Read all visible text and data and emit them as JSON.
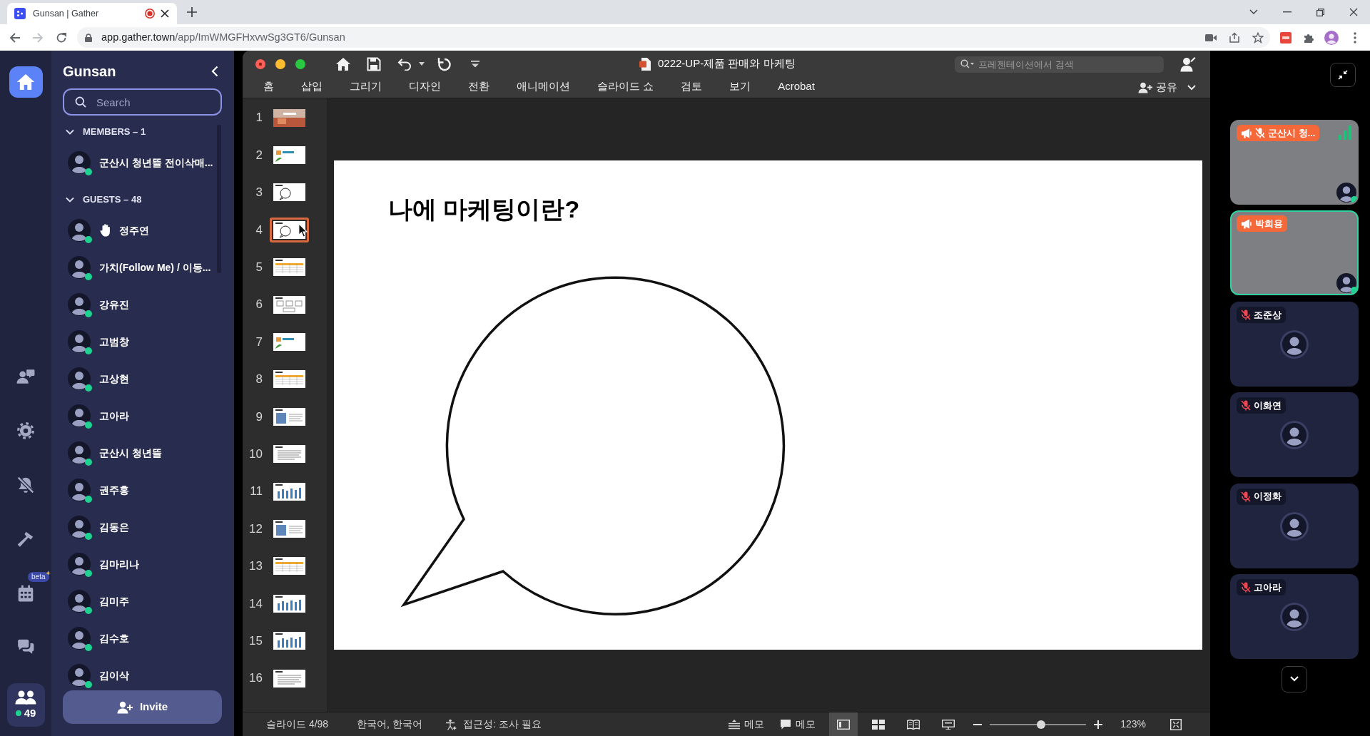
{
  "browser": {
    "tab_title": "Gunsan | Gather",
    "recording": true,
    "address": {
      "host": "app.gather.town",
      "path": "/app/ImWMGFHxvwSg3GT6/Gunsan"
    }
  },
  "rail": {
    "items": [
      {
        "selected": true
      },
      {
        "selected": false
      },
      {
        "selected": false
      },
      {
        "selected": false
      },
      {
        "selected": false
      },
      {
        "selected": false,
        "badge": "beta"
      },
      {
        "selected": false
      }
    ],
    "people_button": {
      "selected": true,
      "count": "49"
    }
  },
  "sidebar": {
    "title": "Gunsan",
    "search": {
      "placeholder": "Search"
    },
    "groups": [
      {
        "label": "MEMBERS – 1",
        "expanded": true,
        "people": [
          {
            "name": "군산시 청년뜰 전이삭매...",
            "online": true,
            "hand_raised": false
          }
        ]
      },
      {
        "label": "GUESTS – 48",
        "expanded": true,
        "people": [
          {
            "name": "정주연",
            "online": true,
            "hand_raised": true
          },
          {
            "name": "가치(Follow Me) / 이동...",
            "online": true,
            "hand_raised": false
          },
          {
            "name": "강유진",
            "online": true,
            "hand_raised": false
          },
          {
            "name": "고범창",
            "online": true,
            "hand_raised": false
          },
          {
            "name": "고상현",
            "online": true,
            "hand_raised": false
          },
          {
            "name": "고아라",
            "online": true,
            "hand_raised": false
          },
          {
            "name": "군산시 청년뜰",
            "online": true,
            "hand_raised": false
          },
          {
            "name": "권주홍",
            "online": true,
            "hand_raised": false
          },
          {
            "name": "김동은",
            "online": true,
            "hand_raised": false
          },
          {
            "name": "김마리나",
            "online": true,
            "hand_raised": false
          },
          {
            "name": "김미주",
            "online": true,
            "hand_raised": false
          },
          {
            "name": "김수호",
            "online": true,
            "hand_raised": false
          },
          {
            "name": "김이삭",
            "online": true,
            "hand_raised": false
          }
        ]
      }
    ],
    "invite_button": "Invite"
  },
  "presentation": {
    "title": "0222-UP-제품 판매와 마케팅",
    "search": {
      "placeholder": "프레젠테이션에서 검색"
    },
    "ribbon_tabs": [
      {
        "label": "홈",
        "selected": false
      },
      {
        "label": "삽입",
        "selected": false
      },
      {
        "label": "그리기",
        "selected": false
      },
      {
        "label": "디자인",
        "selected": false
      },
      {
        "label": "전환",
        "selected": false
      },
      {
        "label": "애니메이션",
        "selected": false
      },
      {
        "label": "슬라이드 쇼",
        "selected": false
      },
      {
        "label": "검토",
        "selected": false
      },
      {
        "label": "보기",
        "selected": false
      },
      {
        "label": "Acrobat",
        "selected": false
      }
    ],
    "share_button": "공유",
    "thumbnails": [
      {
        "number": "1",
        "kind": "photo",
        "selected": false
      },
      {
        "number": "2",
        "kind": "logo",
        "selected": false
      },
      {
        "number": "3",
        "kind": "bubble",
        "selected": false
      },
      {
        "number": "4",
        "kind": "bubble",
        "selected": true
      },
      {
        "number": "5",
        "kind": "table",
        "selected": false
      },
      {
        "number": "6",
        "kind": "diagram",
        "selected": false
      },
      {
        "number": "7",
        "kind": "logo",
        "selected": false
      },
      {
        "number": "8",
        "kind": "table",
        "selected": false
      },
      {
        "number": "9",
        "kind": "image",
        "selected": false
      },
      {
        "number": "10",
        "kind": "text",
        "selected": false
      },
      {
        "number": "11",
        "kind": "chart",
        "selected": false
      },
      {
        "number": "12",
        "kind": "image",
        "selected": false
      },
      {
        "number": "13",
        "kind": "table",
        "selected": false
      },
      {
        "number": "14",
        "kind": "chart",
        "selected": false
      },
      {
        "number": "15",
        "kind": "chart",
        "selected": false
      },
      {
        "number": "16",
        "kind": "text",
        "selected": false
      }
    ],
    "slide": {
      "title": "나에 마케팅이란?"
    },
    "status_bar": {
      "slide_indicator": "슬라이드 4/98",
      "language": "한국어, 한국어",
      "accessibility": "접근성: 조사 필요",
      "notes_button": "메모",
      "comments_button": "메모",
      "views": [
        {
          "selected": true
        },
        {
          "selected": false
        },
        {
          "selected": false
        },
        {
          "selected": false
        }
      ],
      "zoom": {
        "level": 0.53,
        "reading": "123%"
      }
    }
  },
  "video_panel": {
    "tiles": [
      {
        "kind": "video",
        "name": "군산시 청...",
        "presenting": true,
        "muted": true,
        "speaking": false,
        "online": true,
        "signal": true
      },
      {
        "kind": "video",
        "name": "박희용",
        "presenting": true,
        "muted": false,
        "speaking": true,
        "online": true,
        "signal": false
      },
      {
        "kind": "avatar",
        "name": "조준상",
        "presenting": false,
        "muted": true,
        "speaking": false,
        "online": false,
        "signal": false
      },
      {
        "kind": "avatar",
        "name": "이화연",
        "presenting": false,
        "muted": true,
        "speaking": false,
        "online": false,
        "signal": false
      },
      {
        "kind": "avatar",
        "name": "이정화",
        "presenting": false,
        "muted": true,
        "speaking": false,
        "online": false,
        "signal": false
      },
      {
        "kind": "avatar",
        "name": "고아라",
        "presenting": false,
        "muted": true,
        "speaking": false,
        "online": false,
        "signal": false
      }
    ]
  }
}
